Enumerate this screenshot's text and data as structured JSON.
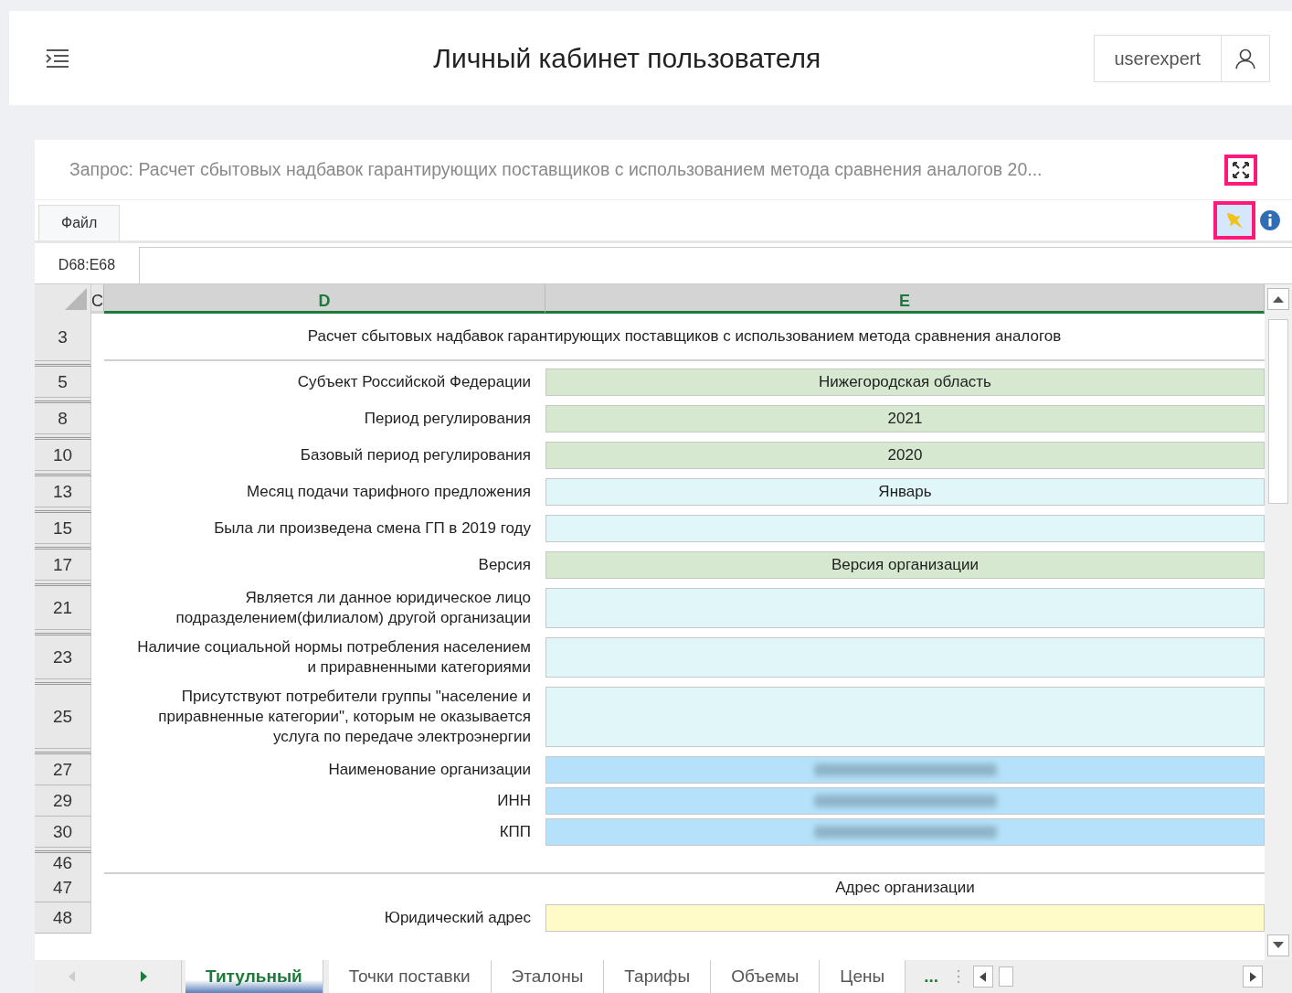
{
  "header": {
    "title": "Личный кабинет пользователя",
    "user": "userexpert"
  },
  "request": {
    "title": "Запрос: Расчет сбытовых надбавок гарантирующих поставщиков с использованием метода сравнения аналогов 20...",
    "expand_annotated": true
  },
  "ribbon": {
    "tab": "Файл",
    "pin_on": true,
    "pin_annotated": true
  },
  "formula_bar": {
    "cell": "D68:E68"
  },
  "sheet": {
    "columns": [
      {
        "label": "C",
        "selected": false
      },
      {
        "label": "D",
        "selected": true
      },
      {
        "label": "E",
        "selected": true
      }
    ],
    "rows": [
      {
        "kind": "title",
        "number": "3",
        "text": "Расчет сбытовых надбавок гарантирующих поставщиков с использованием метода сравнения аналогов"
      },
      {
        "kind": "collapsed"
      },
      {
        "kind": "field",
        "number": "5",
        "label": "Субъект Российской Федерации",
        "value": "Нижегородская область",
        "color": "#d6e8d0"
      },
      {
        "kind": "collapsed"
      },
      {
        "kind": "field",
        "number": "8",
        "label": "Период регулирования",
        "value": "2021",
        "color": "#d6e8d0"
      },
      {
        "kind": "collapsed"
      },
      {
        "kind": "field",
        "number": "10",
        "label": "Базовый период регулирования",
        "value": "2020",
        "color": "#d6e8d0"
      },
      {
        "kind": "collapsed"
      },
      {
        "kind": "field",
        "number": "13",
        "label": "Месяц подачи тарифного предложения",
        "value": "Январь",
        "color": "#e0f6f9"
      },
      {
        "kind": "collapsed"
      },
      {
        "kind": "field",
        "number": "15",
        "label": "Была ли произведена смена ГП в 2019 году",
        "color": "#e0f6f9"
      },
      {
        "kind": "collapsed"
      },
      {
        "kind": "field",
        "number": "17",
        "label": "Версия",
        "value": "Версия организации",
        "color": "#d6e8d0"
      },
      {
        "kind": "collapsed"
      },
      {
        "kind": "field",
        "number": "21",
        "label": "Является ли данное юридическое лицо подразделением(филиалом) другой организации",
        "color": "#e0f6f9"
      },
      {
        "kind": "collapsed"
      },
      {
        "kind": "field",
        "number": "23",
        "label": "Наличие социальной нормы потребления населением и приравненными категориями",
        "color": "#e0f6f9"
      },
      {
        "kind": "collapsed"
      },
      {
        "kind": "field",
        "number": "25",
        "label": "Присутствуют потребители группы \"население и приравненные категории\", которым не оказывается услуга по передаче электроэнергии",
        "color": "#e0f6f9"
      },
      {
        "kind": "collapsed"
      },
      {
        "kind": "field",
        "number": "27",
        "label": "Наименование организации",
        "redacted": true,
        "color": "#b5e2fa"
      },
      {
        "kind": "field",
        "number": "29",
        "label": "ИНН",
        "redacted": true,
        "color": "#b5e2fa"
      },
      {
        "kind": "field",
        "number": "30",
        "label": "КПП",
        "redacted": true,
        "color": "#b5e2fa"
      },
      {
        "kind": "collapsed"
      },
      {
        "kind": "rule",
        "number": "46"
      },
      {
        "kind": "section",
        "number": "47",
        "text": "Адрес организации"
      },
      {
        "kind": "field",
        "number": "48",
        "label": "Юридический адрес",
        "color": "#fffbc8"
      }
    ]
  },
  "sheet_tabs": [
    {
      "label": "Титульный",
      "selected": true
    },
    {
      "label": "Точки поставки",
      "selected": false
    },
    {
      "label": "Эталоны",
      "selected": false
    },
    {
      "label": "Тарифы",
      "selected": false
    },
    {
      "label": "Объемы",
      "selected": false
    },
    {
      "label": "Цены",
      "selected": false
    }
  ],
  "more_tabs": "..."
}
